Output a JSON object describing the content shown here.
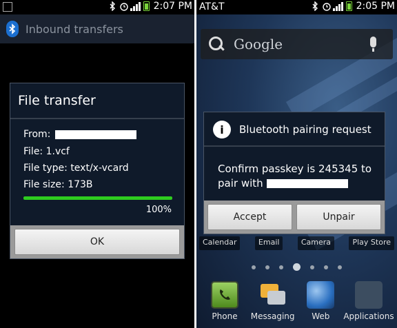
{
  "left": {
    "status": {
      "time": "2:07 PM"
    },
    "app_title": "Inbound transfers",
    "dialog": {
      "title": "File transfer",
      "from_label": "From:",
      "file_label": "File: 1.vcf",
      "type_label": "File type: text/x-vcard",
      "size_label": "File size: 173B",
      "progress": 1.0,
      "progress_text": "100%",
      "ok_label": "OK"
    }
  },
  "right": {
    "status": {
      "carrier": "AT&T",
      "time": "2:05 PM"
    },
    "search": {
      "placeholder": "Google"
    },
    "dialog": {
      "title": "Bluetooth pairing request",
      "message_line1": "Confirm passkey is 245345 to",
      "message_line2": "pair with",
      "accept_label": "Accept",
      "unpair_label": "Unpair"
    },
    "dock_labels": [
      "Calendar",
      "Email",
      "Camera",
      "Play Store"
    ],
    "apps": [
      {
        "label": "Phone",
        "icon": "phone-icon"
      },
      {
        "label": "Messaging",
        "icon": "messaging-icon"
      },
      {
        "label": "Web",
        "icon": "globe-icon"
      },
      {
        "label": "Applications",
        "icon": "apps-grid-icon"
      }
    ]
  },
  "colors": {
    "progress": "#2ecc1f",
    "battery": "#7ad43a",
    "bluetooth": "#1b6fd0"
  }
}
